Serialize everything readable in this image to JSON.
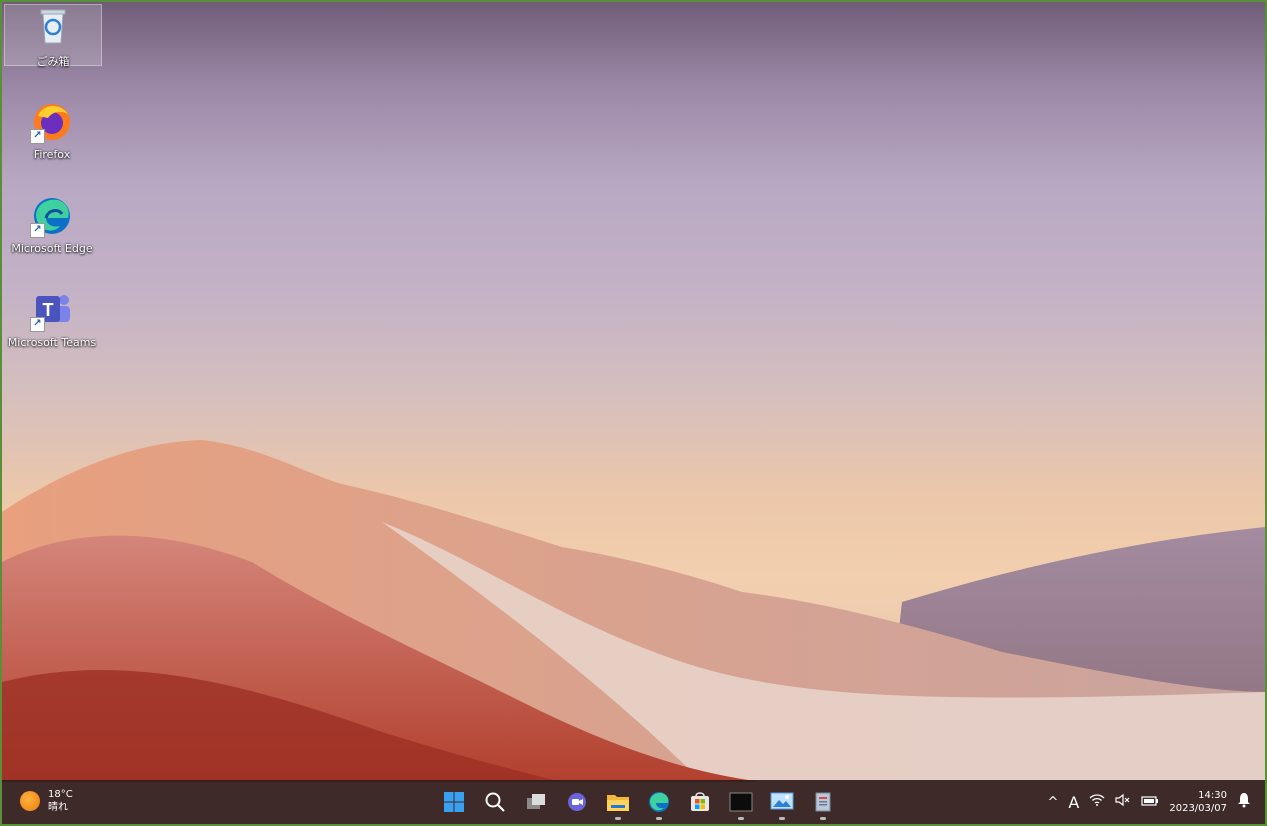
{
  "desktop": {
    "icons": [
      {
        "name": "recycle-bin",
        "label": "ごみ箱"
      },
      {
        "name": "firefox",
        "label": "Firefox"
      },
      {
        "name": "microsoft-edge",
        "label": "Microsoft Edge"
      },
      {
        "name": "microsoft-teams",
        "label": "Microsoft Teams"
      }
    ]
  },
  "taskbar": {
    "weather": {
      "temperature": "18°C",
      "condition": "晴れ",
      "icon": "sun-icon"
    },
    "apps": [
      {
        "name": "start-button",
        "icon": "windows-logo-icon"
      },
      {
        "name": "search-button",
        "icon": "search-icon"
      },
      {
        "name": "task-view-button",
        "icon": "task-view-icon"
      },
      {
        "name": "chat-button",
        "icon": "chat-icon"
      },
      {
        "name": "file-explorer-button",
        "icon": "folder-icon"
      },
      {
        "name": "edge-button",
        "icon": "edge-icon"
      },
      {
        "name": "store-button",
        "icon": "store-icon"
      },
      {
        "name": "terminal-button",
        "icon": "terminal-icon"
      },
      {
        "name": "photos-button",
        "icon": "photos-icon"
      },
      {
        "name": "notepad-button",
        "icon": "notepad-icon"
      }
    ],
    "tray": {
      "chevron": "^",
      "ime": "A",
      "wifi_icon": "wifi-icon",
      "volume_icon": "volume-muted-icon",
      "battery_icon": "battery-charging-icon"
    },
    "clock": {
      "time": "14:30",
      "date": "2023/03/07"
    }
  },
  "colors": {
    "taskbar": "#301c1e",
    "accent_blue": "#0078d4",
    "frame_border": "#5a8f3a"
  }
}
